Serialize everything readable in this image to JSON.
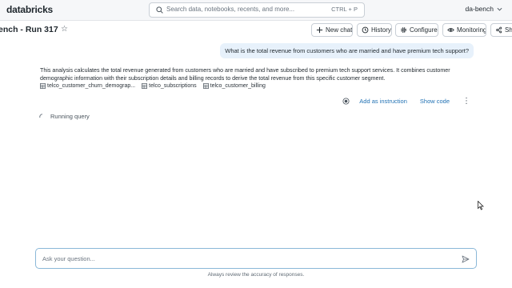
{
  "topbar": {
    "logo": "databricks",
    "search_placeholder": "Search data, notebooks, recents, and more...",
    "search_shortcut": "CTRL + P",
    "user": "da-bench"
  },
  "header": {
    "title": "ench - Run 317",
    "buttons": {
      "new_chat": "New chat",
      "history": "History",
      "configure": "Configure",
      "monitoring": "Monitoring",
      "share": "Sha"
    }
  },
  "conversation": {
    "user_message": "What is the total revenue from customers who are married and have premium tech support?",
    "assistant_text": "This analysis calculates the total revenue generated from customers who are married and have subscribed to premium tech support services. It combines customer demographic information with their subscription details and billing records to derive the total revenue from this specific customer segment.",
    "tables": [
      "telco_customer_churn_demograp...",
      "telco_subscriptions",
      "telco_customer_billing"
    ],
    "actions": {
      "add_instruction": "Add as instruction",
      "show_code": "Show code"
    },
    "status": "Running query"
  },
  "composer": {
    "placeholder": "Ask your question...",
    "disclaimer": "Always review the accuracy of responses."
  }
}
